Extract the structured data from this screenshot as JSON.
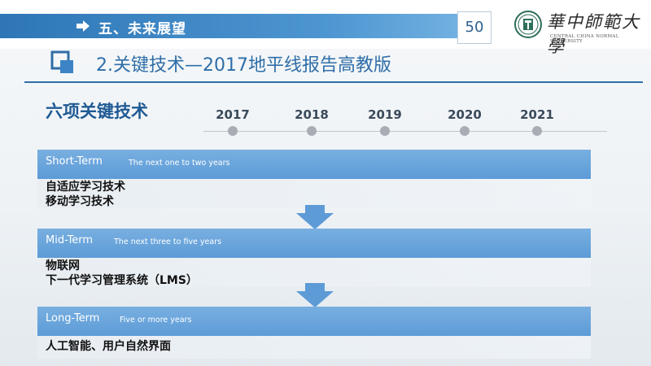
{
  "header": {
    "section_title": "五、未来展望",
    "page_number": "50",
    "university_cn": "華中師範大學",
    "university_en": "CENTRAL CHINA NORMAL UNIVERSITY"
  },
  "slide": {
    "title": "2.关键技术—2017地平线报告高教版",
    "subtitle": "六项关键技术"
  },
  "timeline": {
    "years": [
      "2017",
      "2018",
      "2019",
      "2020",
      "2021"
    ]
  },
  "terms": [
    {
      "name": "Short-Term",
      "desc": "The next one to two years",
      "items": [
        "自适应学习技术",
        "移动学习技术"
      ]
    },
    {
      "name": "Mid-Term",
      "desc": "The next three to five years",
      "items": [
        "物联网",
        "下一代学习管理系统（LMS）"
      ]
    },
    {
      "name": "Long-Term",
      "desc": "Five or more years",
      "items": [
        "人工智能、用户自然界面"
      ]
    }
  ],
  "colors": {
    "accent": "#2f6ea8",
    "bar": "#5d9bd7",
    "dot": "#a7adb3"
  }
}
